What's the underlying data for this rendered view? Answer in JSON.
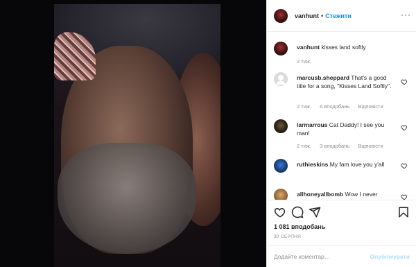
{
  "post": {
    "username": "vanhunt",
    "follow_label": "Стежити",
    "dot": "•",
    "more_label": "···"
  },
  "caption": {
    "username": "vanhunt",
    "text": "kisses land softly",
    "time": "2 тиж."
  },
  "comments": [
    {
      "username": "marcusb.sheppard",
      "text": "That's a good title for a song, \"Kisses Land Softly\".",
      "time": "2 тиж.",
      "likes": "6 вподобань",
      "reply": "Відповісти"
    },
    {
      "username": "larmarrous",
      "text": "Cat Daddy! I see you man!",
      "time": "2 тиж.",
      "likes": "3 вподобань",
      "reply": "Відповісти"
    },
    {
      "username": "ruthieskins",
      "text": "My fam love you y'all",
      "time": "",
      "likes": "",
      "reply": ""
    },
    {
      "username": "allhoneyallbomb",
      "text": "Wow I never",
      "time": "",
      "likes": "",
      "reply": ""
    }
  ],
  "stats": {
    "likes": "1 081 вподобань",
    "date": "30 СЕРПНЯ"
  },
  "composer": {
    "placeholder": "Додайте коментар…",
    "publish_label": "Опублікувати"
  },
  "colors": {
    "accent": "#0095f6",
    "publish_disabled": "#b2dffc",
    "secondary_text": "#8e8e8e"
  },
  "icons": [
    "heart-icon",
    "comment-icon",
    "share-icon",
    "bookmark-icon",
    "more-icon"
  ]
}
